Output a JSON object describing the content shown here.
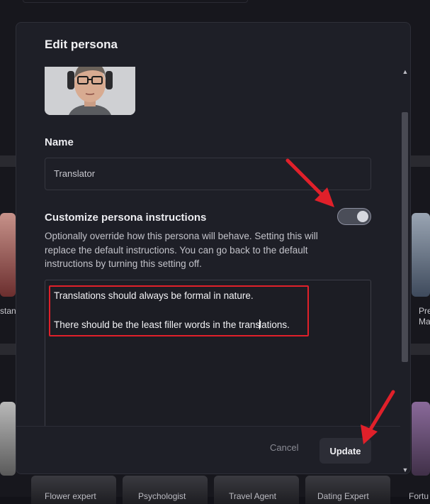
{
  "modal": {
    "title": "Edit persona",
    "name_label": "Name",
    "name_value": "Translator",
    "custom_label": "Customize persona instructions",
    "toggle_on": true,
    "help_text": "Optionally override how this persona will behave. Setting this will replace the default instructions. You can go back to the default instructions by turning this setting off.",
    "instructions": {
      "line1": "Translations should always be formal in nature.",
      "line2_before_caret": "There should be the least filler words in the trans",
      "line2_after_caret": "lations."
    },
    "cancel_label": "Cancel",
    "update_label": "Update"
  },
  "background": {
    "left_label": "stan",
    "right_label_1": "Pre",
    "right_label_2": "Ma",
    "bottom_labels": [
      "Flower expert",
      "Psychologist",
      "Travel Agent",
      "Dating Expert",
      "Fortu"
    ]
  },
  "colors": {
    "annotation_red": "#e0202a",
    "modal_bg": "#1e1f27",
    "page_bg": "#17171d"
  },
  "icons": [
    "scroll-up-arrow-icon",
    "scroll-down-arrow-icon",
    "annotation-arrow-icon"
  ]
}
